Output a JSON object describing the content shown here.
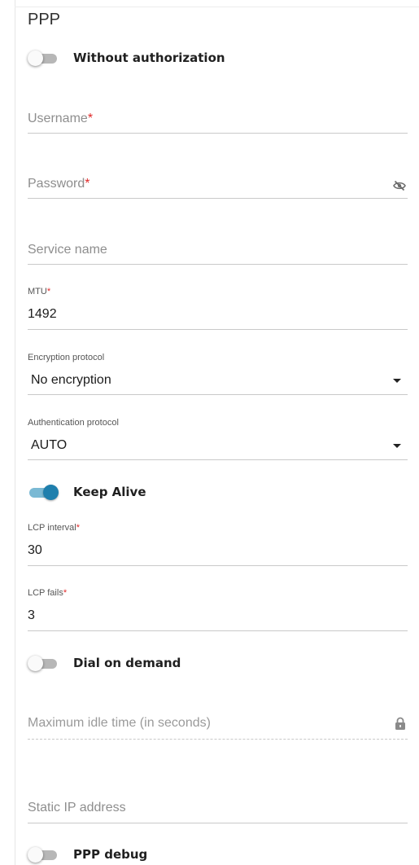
{
  "section": {
    "title": "PPP"
  },
  "without_authorization": {
    "label": "Without authorization",
    "enabled": false
  },
  "username": {
    "placeholder": "Username",
    "required_mark": "*",
    "value": ""
  },
  "password": {
    "placeholder": "Password",
    "required_mark": "*",
    "value": "",
    "icon": "eye-off-icon"
  },
  "service_name": {
    "placeholder": "Service name",
    "value": ""
  },
  "mtu": {
    "label": "MTU",
    "required_mark": "*",
    "value": "1492"
  },
  "encryption_protocol": {
    "label": "Encryption protocol",
    "value": "No encryption"
  },
  "authentication_protocol": {
    "label": "Authentication protocol",
    "value": "AUTO"
  },
  "keep_alive": {
    "label": "Keep Alive",
    "enabled": true
  },
  "lcp_interval": {
    "label": "LCP interval",
    "required_mark": "*",
    "value": "30"
  },
  "lcp_fails": {
    "label": "LCP fails",
    "required_mark": "*",
    "value": "3"
  },
  "dial_on_demand": {
    "label": "Dial on demand",
    "enabled": false
  },
  "max_idle_time": {
    "placeholder": "Maximum idle time (in seconds)",
    "value": "",
    "icon": "lock-icon",
    "disabled": true
  },
  "static_ip": {
    "placeholder": "Static IP address",
    "value": ""
  },
  "ppp_debug": {
    "label": "PPP debug",
    "enabled": false
  },
  "colors": {
    "accent": "#1f7fad",
    "required": "#e02a2a"
  }
}
